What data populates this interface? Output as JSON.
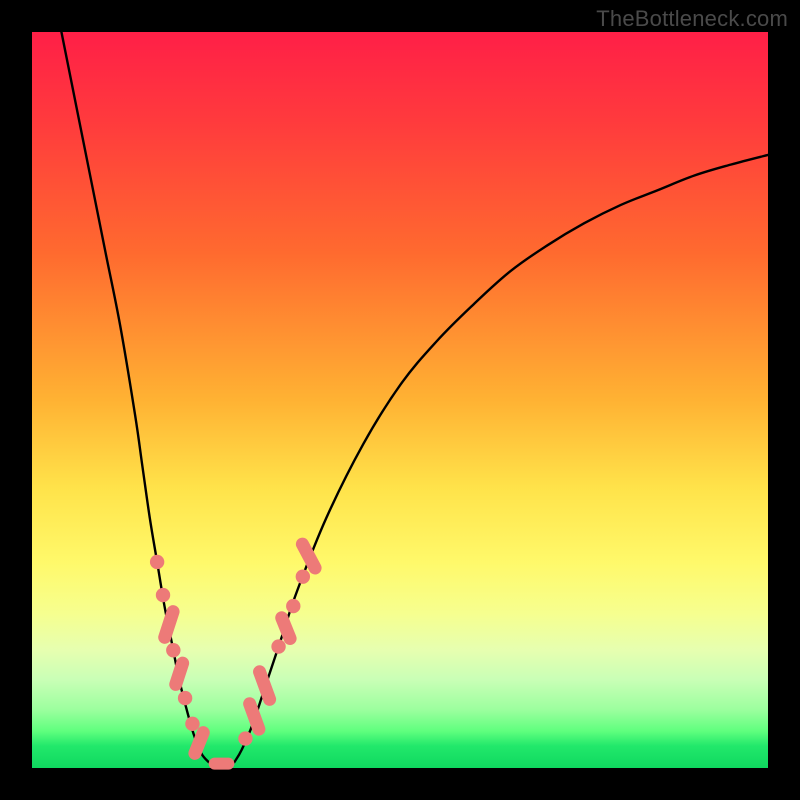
{
  "watermark": "TheBottleneck.com",
  "colors": {
    "frame": "#000000",
    "curve_stroke": "#000000",
    "marker_fill": "#ed7a78",
    "marker_rect_fill": "#ed7a78",
    "gradient_top": "#ff1f47",
    "gradient_bottom": "#0fd85f"
  },
  "chart_data": {
    "type": "line",
    "title": "",
    "xlabel": "",
    "ylabel": "",
    "xlim": [
      0,
      100
    ],
    "ylim": [
      0,
      100
    ],
    "grid": false,
    "legend": false,
    "curves": [
      {
        "name": "left-branch",
        "x": [
          4,
          6,
          8,
          10,
          12,
          14,
          15,
          16,
          17,
          18,
          19,
          20,
          21,
          22,
          23,
          24
        ],
        "y": [
          100,
          90,
          80,
          70,
          60,
          48,
          41,
          34,
          28,
          22,
          17,
          12,
          8,
          4.5,
          2,
          0.8
        ]
      },
      {
        "name": "right-branch",
        "x": [
          27.5,
          28.5,
          30,
          32,
          34,
          36,
          40,
          45,
          50,
          55,
          60,
          65,
          70,
          75,
          80,
          85,
          90,
          95,
          100
        ],
        "y": [
          0.8,
          2.5,
          6,
          12,
          18,
          24,
          34,
          44,
          52,
          58,
          63,
          67.5,
          71,
          74,
          76.5,
          78.5,
          80.5,
          82,
          83.3
        ]
      }
    ],
    "bottom_bar": {
      "x0": 24,
      "x1": 27.5,
      "y": 0.6
    },
    "markers_circles": [
      {
        "curve": "left-branch",
        "x": 17.0,
        "y": 28.0
      },
      {
        "curve": "left-branch",
        "x": 17.8,
        "y": 23.5
      },
      {
        "curve": "left-branch",
        "x": 19.2,
        "y": 16.0
      },
      {
        "curve": "left-branch",
        "x": 20.8,
        "y": 9.5
      },
      {
        "curve": "left-branch",
        "x": 21.8,
        "y": 6.0
      },
      {
        "curve": "right-branch",
        "x": 29.0,
        "y": 4.0
      },
      {
        "curve": "right-branch",
        "x": 33.5,
        "y": 16.5
      },
      {
        "curve": "right-branch",
        "x": 35.5,
        "y": 22.0
      },
      {
        "curve": "right-branch",
        "x": 36.8,
        "y": 26.0
      }
    ],
    "markers_pills": [
      {
        "curve": "left-branch",
        "x": 18.6,
        "y": 19.5,
        "len": 3.4,
        "angle": -72
      },
      {
        "curve": "left-branch",
        "x": 20.0,
        "y": 12.8,
        "len": 3.0,
        "angle": -72
      },
      {
        "curve": "left-branch",
        "x": 22.7,
        "y": 3.4,
        "len": 3.0,
        "angle": -68
      },
      {
        "curve": "right-branch",
        "x": 30.2,
        "y": 7.0,
        "len": 3.4,
        "angle": 70
      },
      {
        "curve": "right-branch",
        "x": 31.6,
        "y": 11.2,
        "len": 3.6,
        "angle": 70
      },
      {
        "curve": "right-branch",
        "x": 34.5,
        "y": 19.0,
        "len": 3.0,
        "angle": 68
      },
      {
        "curve": "right-branch",
        "x": 37.6,
        "y": 28.8,
        "len": 3.4,
        "angle": 62
      }
    ]
  }
}
